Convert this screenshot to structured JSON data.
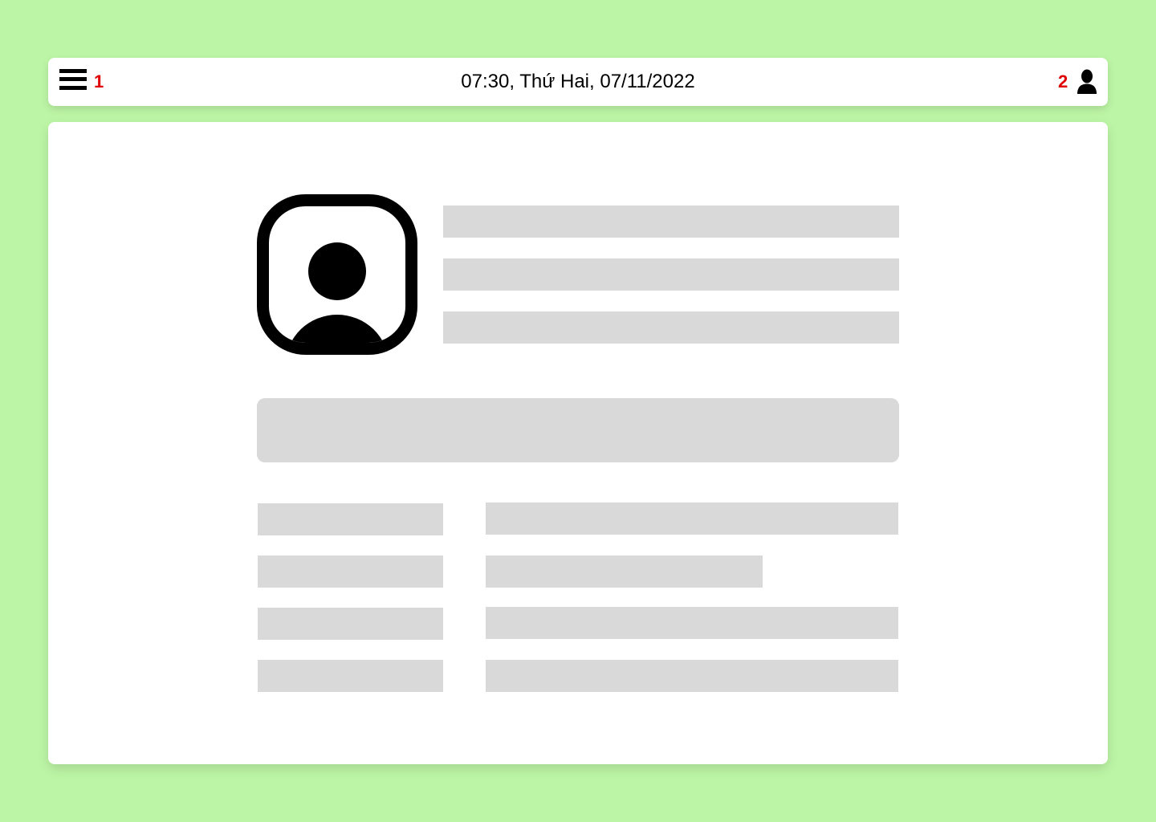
{
  "header": {
    "menu_marker": "1",
    "datetime": "07:30, Thứ Hai, 07/11/2022",
    "user_marker": "2",
    "menu_icon": "hamburger-menu-icon",
    "user_icon": "user-silhouette-icon"
  },
  "profile": {
    "avatar_icon": "user-avatar-icon"
  },
  "colors": {
    "background": "#bdf5a6",
    "surface": "#ffffff",
    "placeholder": "#d9d9d9",
    "marker": "#e00000"
  }
}
